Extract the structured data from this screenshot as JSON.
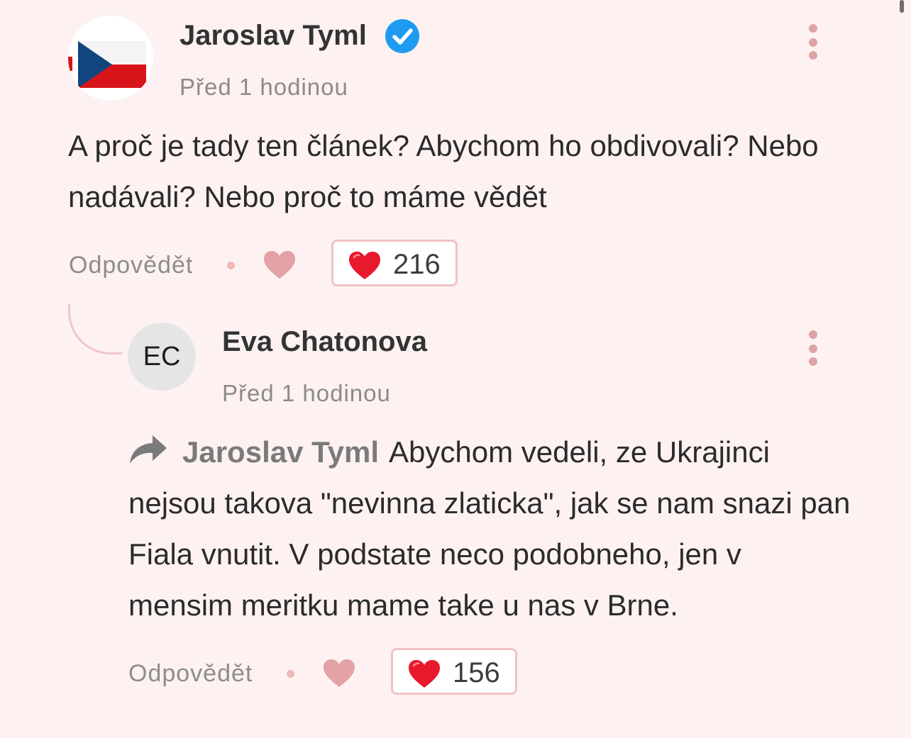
{
  "comments": [
    {
      "author": "Jaroslav Tyml",
      "verified": true,
      "avatar_icon": "czech-flag",
      "time": "Před 1 hodinou",
      "text": "A proč je tady ten článek? Abychom ho obdivovali? Nebo nadávali? Nebo proč to máme vědět",
      "reply_label": "Odpovědět",
      "likes": "216"
    },
    {
      "author": "Eva Chatonova",
      "avatar_initials": "EC",
      "time": "Před 1 hodinou",
      "reply_to": "Jaroslav Tyml",
      "text": "Abychom vedeli, ze Ukrajinci nejsou takova \"nevinna zlaticka\", jak se nam snazi pan Fiala vnutit. V podstate neco podobneho, jen v mensim meritku mame take u nas v Brne.",
      "reply_label": "Odpovědět",
      "likes": "156"
    }
  ],
  "colors": {
    "background": "#fdf2f1",
    "verified_badge": "#1d9bf0",
    "heart": "#e8192c",
    "heart_outline": "#e3a2a5",
    "kebab": "#dda4a6"
  },
  "icons": [
    "verified-badge-icon",
    "more-options-icon",
    "heart-outline-icon",
    "heart-filled-icon",
    "reply-arrow-icon"
  ]
}
